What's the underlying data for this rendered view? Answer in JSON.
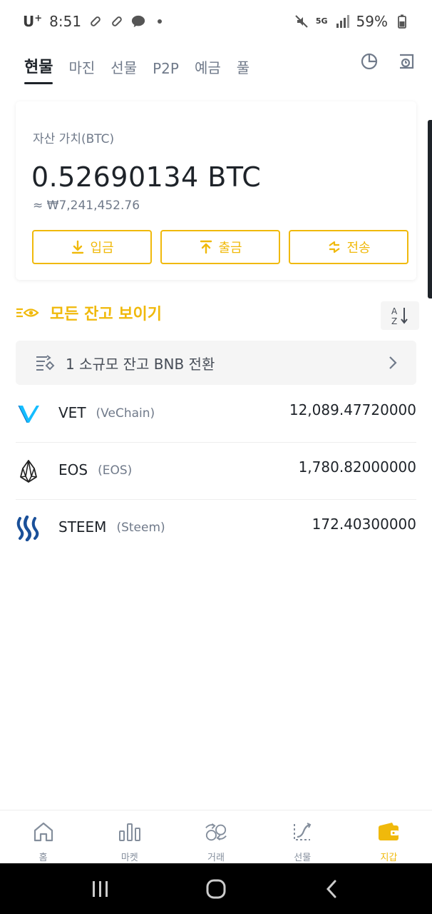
{
  "status_bar": {
    "carrier": "U",
    "carrier_sup": "+",
    "time": "8:51",
    "network": "5G",
    "battery": "59%"
  },
  "tabs": [
    {
      "label": "현물",
      "active": true
    },
    {
      "label": "마진"
    },
    {
      "label": "선물"
    },
    {
      "label": "P2P"
    },
    {
      "label": "예금"
    },
    {
      "label": "풀"
    }
  ],
  "asset": {
    "label": "자산 가치(BTC)",
    "value": "0.52690134 BTC",
    "fiat": "≈ ₩7,241,452.76",
    "deposit": "입금",
    "withdraw": "출금",
    "transfer": "전송"
  },
  "show_all": "모든 잔고 보이기",
  "convert": "1 소규모 잔고 BNB 전환",
  "coins": [
    {
      "symbol": "VET",
      "name": "(VeChain)",
      "amount": "12,089.47720000"
    },
    {
      "symbol": "EOS",
      "name": "(EOS)",
      "amount": "1,780.82000000"
    },
    {
      "symbol": "STEEM",
      "name": "(Steem)",
      "amount": "172.40300000"
    }
  ],
  "bottom_nav": [
    {
      "label": "홈",
      "icon": "home-icon"
    },
    {
      "label": "마켓",
      "icon": "markets-icon"
    },
    {
      "label": "거래",
      "icon": "trade-icon"
    },
    {
      "label": "선물",
      "icon": "futures-icon"
    },
    {
      "label": "지갑",
      "icon": "wallet-icon",
      "active": true
    }
  ],
  "colors": {
    "accent": "#f0b90b",
    "text_primary": "#1e2329",
    "text_secondary": "#707a8a"
  }
}
